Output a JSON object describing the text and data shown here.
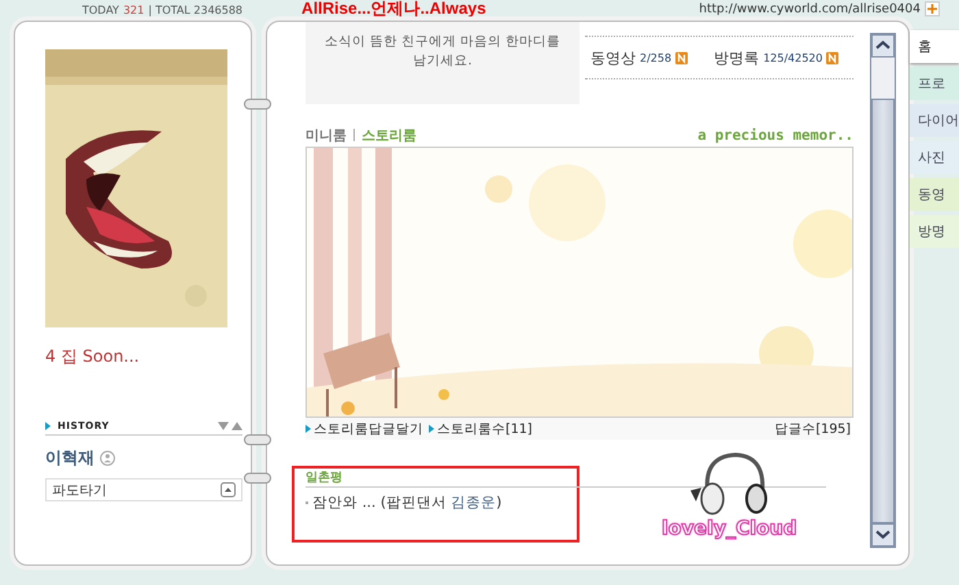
{
  "header": {
    "today_label": "TODAY",
    "today_count": "321",
    "total": "| TOTAL 2346588",
    "title": "AllRise...언제나..Always",
    "url": "http://www.cyworld.com/allrise0404"
  },
  "profile": {
    "status": "4 집 Soon...",
    "history_label": "HISTORY",
    "name": "이혁재",
    "surf_select": "파도타기"
  },
  "notice": {
    "lines": [
      "소식이 뜸한 친구에게 마음의 한마디를",
      "남기세요."
    ]
  },
  "stats": [
    {
      "label": "동영상",
      "value": "2/258",
      "new": true
    },
    {
      "label": "방명록",
      "value": "125/42520",
      "new": true
    }
  ],
  "room_tabs": [
    {
      "label": "미니룸",
      "selected": false
    },
    {
      "label": "스토리룸",
      "selected": true
    }
  ],
  "room_title": "a precious memor..",
  "room_links": [
    "스토리룸답글달기",
    "스토리룸수[11]"
  ],
  "reply_count": "답글수[195]",
  "ilchon": {
    "title": "일촌평",
    "entries": [
      {
        "text": "잠안와 ... (팝핀댄서 ",
        "author": "김종운",
        "close": ")"
      }
    ]
  },
  "sticker_text": "lovely_Cloud",
  "side_tabs": [
    {
      "label": "홈",
      "selected": true
    },
    {
      "label": "프로",
      "selected": false
    },
    {
      "label": "다이어",
      "selected": false
    },
    {
      "label": "사진",
      "selected": false
    },
    {
      "label": "동영",
      "selected": false
    },
    {
      "label": "방명",
      "selected": false
    }
  ]
}
